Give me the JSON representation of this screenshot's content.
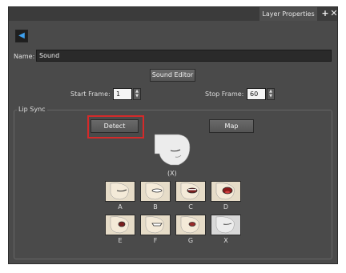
{
  "panel": {
    "tab_label": "Layer Properties",
    "add_icon": "plus-icon",
    "close_icon": "close-icon"
  },
  "layer": {
    "icon": "sound-layer-icon"
  },
  "name": {
    "label": "Name:",
    "value": "Sound"
  },
  "sound_editor": {
    "label": "Sound Editor"
  },
  "frames": {
    "start_label": "Start Frame:",
    "start_value": "1",
    "stop_label": "Stop Frame:",
    "stop_value": "60"
  },
  "lip_sync": {
    "group_label": "Lip Sync",
    "detect_label": "Detect",
    "map_label": "Map",
    "current_phoneme": "(X)",
    "mouths": [
      {
        "label": "A"
      },
      {
        "label": "B"
      },
      {
        "label": "C"
      },
      {
        "label": "D"
      },
      {
        "label": "E"
      },
      {
        "label": "F"
      },
      {
        "label": "G"
      },
      {
        "label": "X"
      }
    ]
  },
  "colors": {
    "highlight": "#d42a2a",
    "panel_bg": "#4a4a4a",
    "icon_accent": "#3ea1f0"
  }
}
